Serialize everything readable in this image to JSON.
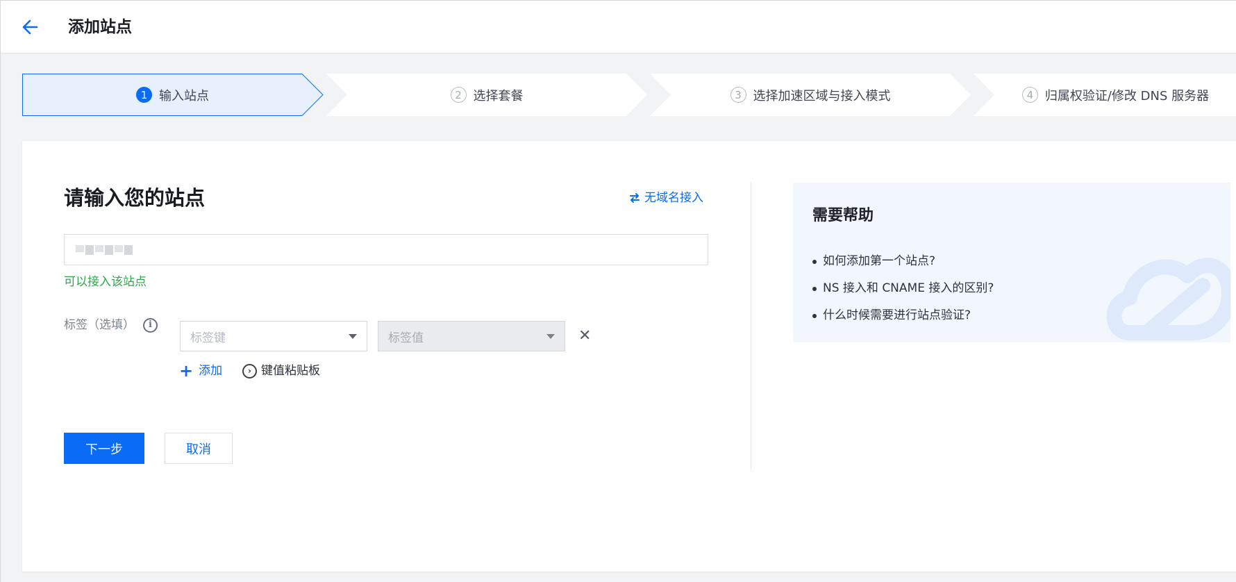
{
  "header": {
    "title": "添加站点",
    "back_icon": "arrow-left-icon"
  },
  "steps": [
    {
      "num": "1",
      "label": "输入站点",
      "active": true
    },
    {
      "num": "2",
      "label": "选择套餐",
      "active": false
    },
    {
      "num": "3",
      "label": "选择加速区域与接入模式",
      "active": false
    },
    {
      "num": "4",
      "label": "归属权验证/修改 DNS 服务器",
      "active": false
    }
  ],
  "form": {
    "title": "请输入您的站点",
    "nodomain_link": "无域名接入",
    "status_text": "可以接入该站点",
    "tag_label": "标签（选填）",
    "tag_key_placeholder": "标签键",
    "tag_value_placeholder": "标签值",
    "add_label": "添加",
    "paste_label": "键值粘贴板",
    "next_button": "下一步",
    "cancel_button": "取消"
  },
  "help": {
    "title": "需要帮助",
    "links": [
      "如何添加第一个站点?",
      "NS 接入和 CNAME 接入的区别?",
      "什么时候需要进行站点验证?"
    ]
  },
  "colors": {
    "primary": "#0a6cf5",
    "success": "#2baa4c",
    "active_step_bg": "#e8f0fd",
    "help_bg": "#f2f6fd"
  }
}
